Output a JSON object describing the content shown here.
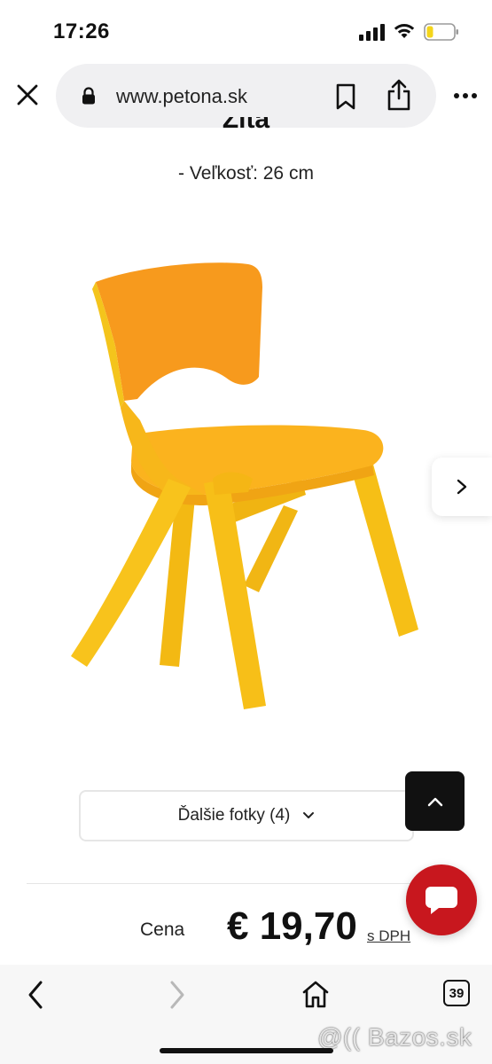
{
  "status_bar": {
    "time": "17:26"
  },
  "browser": {
    "url": "www.petona.sk",
    "tab_count": "39"
  },
  "product": {
    "partial_title": "Žltá",
    "size_line": "- Veľkosť: 26 cm",
    "image_alt": "yellow-children-plastic-chair",
    "more_photos_label": "Ďalšie fotky (4)",
    "price_label": "Cena",
    "price_value": "€ 19,70",
    "price_vat": "s DPH"
  },
  "watermark": "@(( Bazos.sk",
  "colors": {
    "accent_red": "#c8171e",
    "chair_yellow": "#f7c21a",
    "chair_orange": "#f6a11a"
  }
}
